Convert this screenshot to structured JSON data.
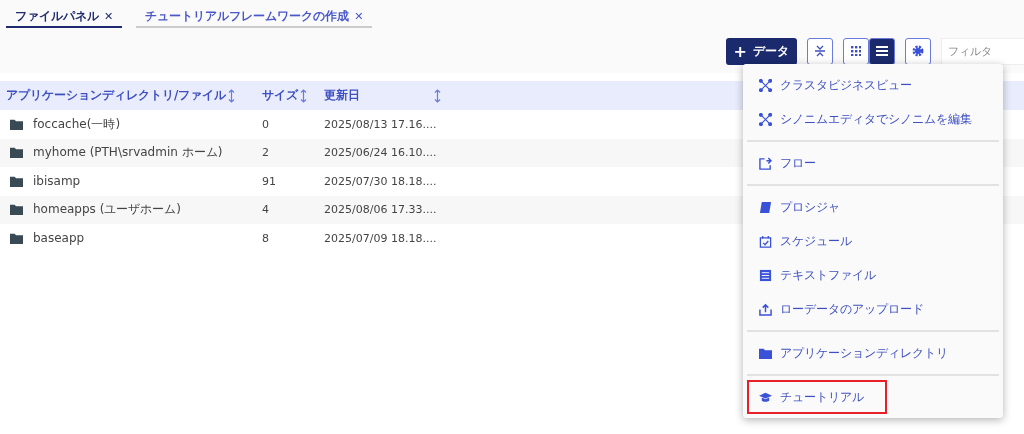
{
  "tabs": [
    {
      "label": "ファイルパネル",
      "close": "✕",
      "selected": true
    },
    {
      "label": "チュートリアルフレームワークの作成",
      "close": "✕",
      "selected": false
    }
  ],
  "toolbar": {
    "add_button": {
      "icon": "+",
      "label": "データ"
    },
    "view_toggle": [
      {
        "kind": "grid",
        "selected": false
      },
      {
        "kind": "list",
        "selected": true
      }
    ],
    "filter": {
      "placeholder": "フィルタ"
    }
  },
  "table": {
    "columns": [
      {
        "label": "アプリケーションディレクトリ/ファイル"
      },
      {
        "label": "サイズ"
      },
      {
        "label": "更新日"
      }
    ],
    "rows": [
      {
        "name": "foccache(一時)",
        "size": "0",
        "modified": "2025/08/13 17.16...."
      },
      {
        "name": "myhome (PTH\\srvadmin ホーム)",
        "size": "2",
        "modified": "2025/06/24 16.10...."
      },
      {
        "name": "ibisamp",
        "size": "91",
        "modified": "2025/07/30 18.18...."
      },
      {
        "name": "homeapps (ユーザホーム)",
        "size": "4",
        "modified": "2025/08/06 17.33...."
      },
      {
        "name": "baseapp",
        "size": "8",
        "modified": "2025/07/09 18.18...."
      }
    ]
  },
  "menu": {
    "groups": [
      [
        {
          "kind": "cluster",
          "label": "クラスタビジネスビュー",
          "highlighted": false
        },
        {
          "kind": "cluster",
          "label": "シノニムエディタでシノニムを編集",
          "highlighted": false
        }
      ],
      [
        {
          "kind": "flow",
          "label": "フロー",
          "highlighted": false
        }
      ],
      [
        {
          "kind": "procedure",
          "label": "プロシジャ",
          "highlighted": false
        },
        {
          "kind": "schedule",
          "label": "スケジュール",
          "highlighted": false
        },
        {
          "kind": "text",
          "label": "テキストファイル",
          "highlighted": false
        },
        {
          "kind": "upload",
          "label": "ローデータのアップロード",
          "highlighted": false
        }
      ],
      [
        {
          "kind": "folder",
          "label": "アプリケーションディレクトリ",
          "highlighted": false
        }
      ],
      [
        {
          "kind": "tutorial",
          "label": "チュートリアル",
          "highlighted": true
        }
      ]
    ]
  }
}
